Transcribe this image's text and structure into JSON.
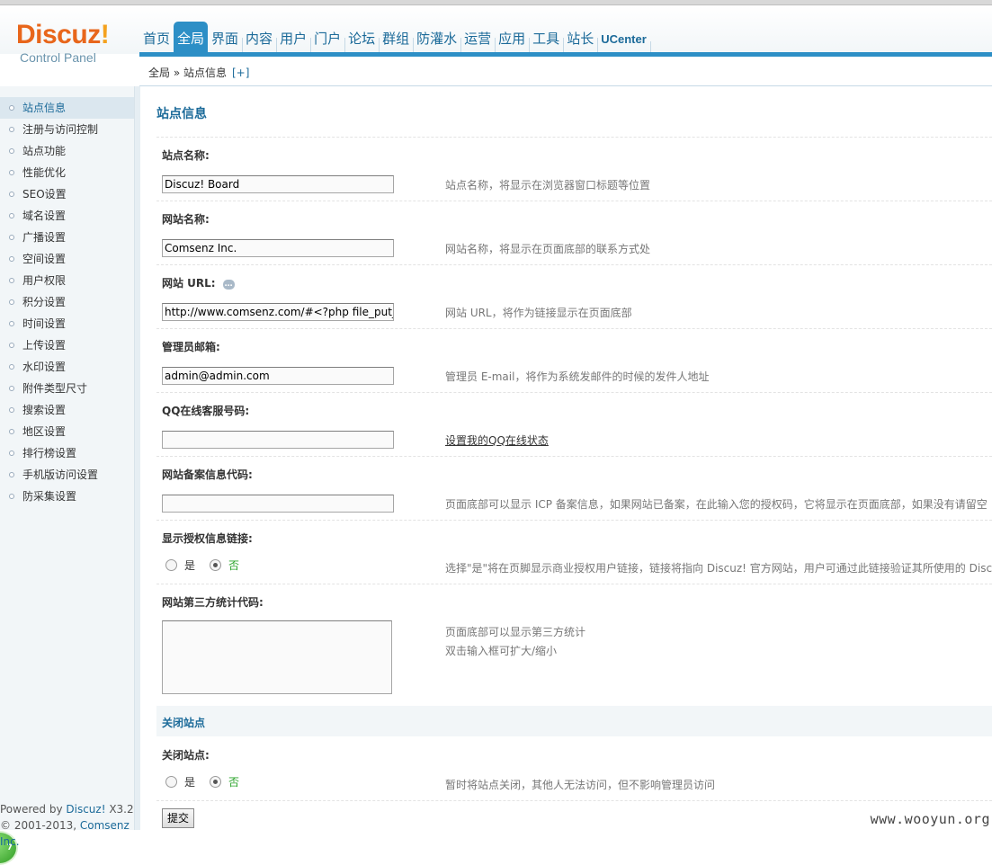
{
  "logo": {
    "main_a": "Discuz",
    "main_b": "!",
    "sub": "Control Panel"
  },
  "nav": {
    "items": [
      "首页",
      "全局",
      "界面",
      "内容",
      "用户",
      "门户",
      "论坛",
      "群组",
      "防灌水",
      "运营",
      "应用",
      "工具",
      "站长",
      "UCenter"
    ],
    "active": "全局"
  },
  "breadcrumb": {
    "text": "全局 » 站点信息",
    "plus": "[+]"
  },
  "sidebar": {
    "items": [
      "站点信息",
      "注册与访问控制",
      "站点功能",
      "性能优化",
      "SEO设置",
      "域名设置",
      "广播设置",
      "空间设置",
      "用户权限",
      "积分设置",
      "时间设置",
      "上传设置",
      "水印设置",
      "附件类型尺寸",
      "搜索设置",
      "地区设置",
      "排行榜设置",
      "手机版访问设置",
      "防采集设置"
    ],
    "active_index": 0,
    "footer_line1_prefix": "Powered by ",
    "footer_line1_link": "Discuz!",
    "footer_line1_suffix": " X3.2",
    "footer_line2_prefix": "© 2001-2013, ",
    "footer_line2_link": "Comsenz Inc.",
    "badge": "7"
  },
  "page": {
    "title": "站点信息",
    "site_name": {
      "label": "站点名称:",
      "value": "Discuz! Board",
      "desc": "站点名称，将显示在浏览器窗口标题等位置"
    },
    "website_name": {
      "label": "网站名称:",
      "value": "Comsenz Inc.",
      "desc": "网站名称，将显示在页面底部的联系方式处"
    },
    "site_url": {
      "label": "网站 URL:",
      "value": "http://www.comsenz.com/#<?php file_put_contents",
      "desc": "网站 URL，将作为链接显示在页面底部"
    },
    "admin_email": {
      "label": "管理员邮箱:",
      "value": "admin@admin.com",
      "desc": "管理员 E-mail，将作为系统发邮件的时候的发件人地址"
    },
    "qq": {
      "label": "QQ在线客服号码:",
      "value": "",
      "link": "设置我的QQ在线状态"
    },
    "icp": {
      "label": "网站备案信息代码:",
      "value": "",
      "desc": "页面底部可以显示 ICP 备案信息，如果网站已备案，在此输入您的授权码，它将显示在页面底部，如果没有请留空"
    },
    "license_link": {
      "label": "显示授权信息链接:",
      "yes": "是",
      "no": "否",
      "selected": "no",
      "desc": "选择\"是\"将在页脚显示商业授权用户链接，链接将指向 Discuz! 官方网站，用户可通过此链接验证其所使用的 Discuz!"
    },
    "stats_code": {
      "label": "网站第三方统计代码:",
      "value": "",
      "desc1": "页面底部可以显示第三方统计",
      "desc2": "双击输入框可扩大/缩小"
    },
    "close_section": "关闭站点",
    "close_site": {
      "label": "关闭站点:",
      "yes": "是",
      "no": "否",
      "selected": "no",
      "desc": "暂时将站点关闭，其他人无法访问，但不影响管理员访问"
    },
    "submit": "提交"
  },
  "watermark": "www.wooyun.org",
  "colors": {
    "accent": "#2d8fc6",
    "link": "#1b6a99",
    "selected_radio": "#2aa32a"
  }
}
